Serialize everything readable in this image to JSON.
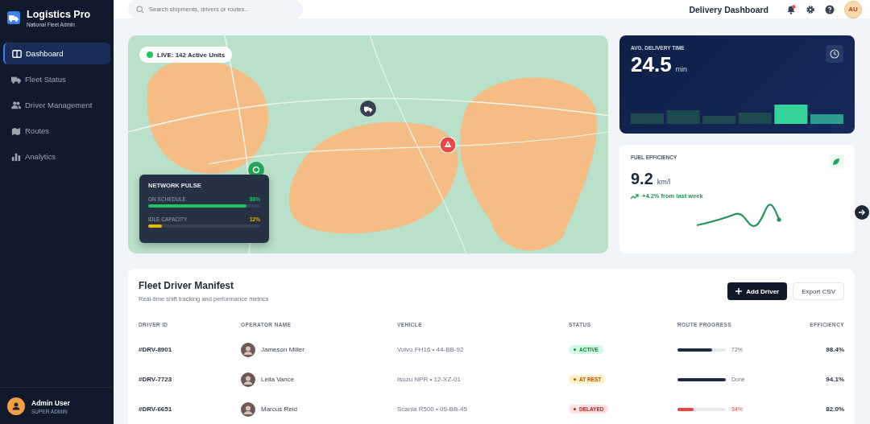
{
  "sidebar": {
    "brand": {
      "title": "Logistics Pro",
      "subtitle": "National Fleet Admin"
    },
    "items": [
      {
        "label": "Dashboard",
        "kind": "layout",
        "selected": true
      },
      {
        "label": "Fleet Status",
        "kind": "truck",
        "selected": false
      },
      {
        "label": "Driver Management",
        "kind": "users",
        "selected": false
      },
      {
        "label": "Routes",
        "kind": "map",
        "selected": false
      },
      {
        "label": "Analytics",
        "kind": "chart",
        "selected": false
      }
    ],
    "user": {
      "name": "Admin User",
      "role": "SUPER ADMIN"
    }
  },
  "header": {
    "search": {
      "placeholder": "Search shipments, drivers or routes..."
    },
    "title": "Delivery Dashboard",
    "notifications_unread": true,
    "avatar": "AU"
  },
  "map": {
    "kind": "picture",
    "live_badge": "LIVE: 142 Active Units",
    "markers": [
      {
        "kind": "truck"
      },
      {
        "kind": "alert"
      },
      {
        "kind": "depot"
      }
    ],
    "network_pulse": {
      "title": "NETWORK PULSE",
      "metrics": [
        {
          "label": "ON SCHEDULE",
          "reading": "88%",
          "level": 0.88,
          "color": "#22c55e"
        },
        {
          "label": "IDLE CAPACITY",
          "reading": "12%",
          "level": 0.12,
          "color": "#eab308"
        }
      ]
    }
  },
  "avg_delivery": {
    "label": "AVG. DELIVERY TIME",
    "value": "24.5",
    "unit": "min"
  },
  "fuel": {
    "label": "FUEL EFFICIENCY",
    "value": "9.2",
    "unit": "km/l",
    "trend": "+4.2% from last week"
  },
  "manifest": {
    "title": "Fleet Driver Manifest",
    "subtitle": "Real-time shift tracking and performance metrics",
    "buttons": [
      {
        "label": "Add Driver",
        "kind": "primary"
      },
      {
        "label": "Export CSV",
        "kind": "secondary"
      }
    ],
    "columns": [
      "DRIVER ID",
      "OPERATOR NAME",
      "VEHICLE",
      "STATUS",
      "ROUTE PROGRESS",
      "EFFICIENCY"
    ],
    "rows": [
      {
        "id": "#DRV-8901",
        "name": "Jameson Miller",
        "vehicle": "Volvo FH16 • 44-BB-92",
        "status": "ACTIVE",
        "kind": "active",
        "level": 0.72,
        "progress": "72%",
        "efficiency": "98.4%"
      },
      {
        "id": "#DRV-7723",
        "name": "Leila Vance",
        "vehicle": "Isuzu NPR • 12-XZ-01",
        "status": "AT REST",
        "kind": "rest",
        "level": 1,
        "progress": "Done",
        "efficiency": "94.1%"
      },
      {
        "id": "#DRV-6651",
        "name": "Marcus Reid",
        "vehicle": "Scania R500 • 09-BB-45",
        "status": "DELAYED",
        "kind": "delayed",
        "level": 0.34,
        "progress": "34%",
        "efficiency": "82.0%"
      }
    ]
  }
}
